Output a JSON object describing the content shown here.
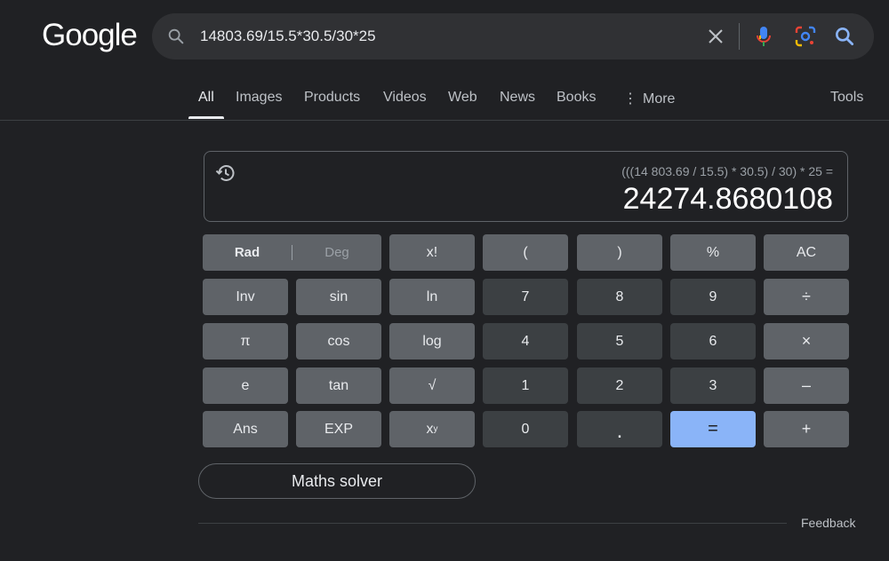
{
  "logo": "Google",
  "search": {
    "query": "14803.69/15.5*30.5/30*25"
  },
  "tabs": [
    {
      "label": "All",
      "active": true
    },
    {
      "label": "Images"
    },
    {
      "label": "Products"
    },
    {
      "label": "Videos"
    },
    {
      "label": "Web"
    },
    {
      "label": "News"
    },
    {
      "label": "Books"
    },
    {
      "label": "More"
    }
  ],
  "tools_label": "Tools",
  "calculator": {
    "expression": "(((14 803.69 / 15.5) * 30.5) / 30) * 25 =",
    "result": "24274.8680108",
    "rad_label": "Rad",
    "deg_label": "Deg",
    "keys": {
      "fact": "x!",
      "lparen": "(",
      "rparen": ")",
      "percent": "%",
      "ac": "AC",
      "inv": "Inv",
      "sin": "sin",
      "ln": "ln",
      "seven": "7",
      "eight": "8",
      "nine": "9",
      "divide": "÷",
      "pi": "π",
      "cos": "cos",
      "log": "log",
      "four": "4",
      "five": "5",
      "six": "6",
      "multiply": "×",
      "e": "e",
      "tan": "tan",
      "sqrt": "√",
      "one": "1",
      "two": "2",
      "three": "3",
      "minus": "–",
      "ans": "Ans",
      "exp": "EXP",
      "pow_base": "x",
      "pow_exp": "y",
      "zero": "0",
      "dot": ".",
      "equals": "=",
      "plus": "+"
    }
  },
  "maths_solver_label": "Maths solver",
  "feedback_label": "Feedback",
  "colors": {
    "background": "#202124",
    "equals_key": "#8ab4f8",
    "func_key": "#5f6368",
    "num_key": "#3c4043"
  }
}
